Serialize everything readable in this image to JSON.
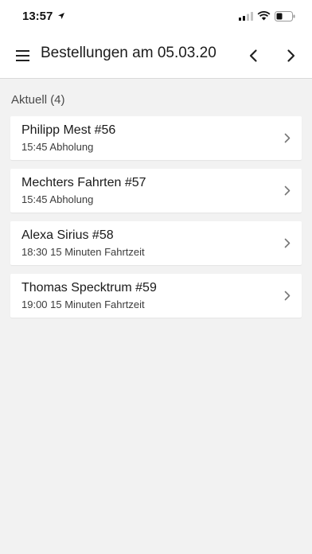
{
  "status_bar": {
    "time": "13:57"
  },
  "header": {
    "title": "Bestellungen am 05.03.20"
  },
  "section": {
    "title": "Aktuell (4)"
  },
  "orders": [
    {
      "name": "Philipp Mest #56",
      "detail": "15:45 Abholung"
    },
    {
      "name": "Mechters Fahrten #57",
      "detail": "15:45 Abholung"
    },
    {
      "name": "Alexa Sirius #58",
      "detail": "18:30 15 Minuten Fahrtzeit"
    },
    {
      "name": "Thomas Specktrum #59",
      "detail": "19:00 15 Minuten Fahrtzeit"
    }
  ],
  "icons": {
    "menu": "hamburger-menu-icon",
    "previous": "chevron-left-icon",
    "next": "chevron-right-icon",
    "row": "chevron-right-icon"
  },
  "colors": {
    "background": "#f2f2f2",
    "surface": "#ffffff",
    "text": "#1a1a1a",
    "chevron": "#777777"
  }
}
